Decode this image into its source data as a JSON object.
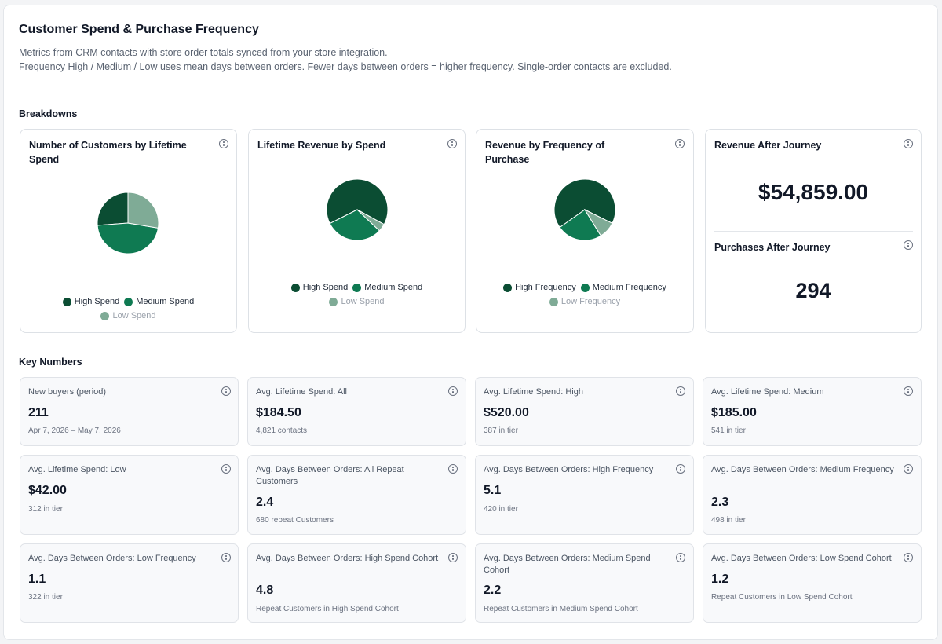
{
  "header": {
    "title": "Customer Spend & Purchase Frequency",
    "subtitle_line1": "Metrics from CRM contacts with store order totals synced from your store integration.",
    "subtitle_line2": "Frequency High / Medium / Low uses mean days between orders. Fewer days between orders = higher frequency. Single-order contacts are excluded."
  },
  "colors": {
    "high": "#0b4d33",
    "medium": "#0f7a52",
    "low": "#7fab96"
  },
  "breakdowns": {
    "label": "Breakdowns",
    "customers_by_spend": {
      "title": "Number of Customers by Lifetime Spend",
      "legend": [
        "High Spend",
        "Medium Spend",
        "Low Spend"
      ],
      "chart_data": {
        "type": "pie",
        "categories": [
          "High Spend",
          "Medium Spend",
          "Low Spend"
        ],
        "values": [
          0.262,
          0.462,
          0.276
        ]
      }
    },
    "revenue_by_spend": {
      "title": "Lifetime Revenue by Spend",
      "legend": [
        "High Spend",
        "Medium Spend",
        "Low Spend"
      ],
      "chart_data": {
        "type": "pie",
        "categories": [
          "High Spend",
          "Medium Spend",
          "Low Spend"
        ],
        "values": [
          0.654,
          0.305,
          0.041
        ]
      }
    },
    "revenue_by_frequency": {
      "title": "Revenue by Frequency of Purchase",
      "legend": [
        "High Frequency",
        "Medium Frequency",
        "Low Frequency"
      ],
      "chart_data": {
        "type": "pie",
        "categories": [
          "High Frequency",
          "Medium Frequency",
          "Low Frequency"
        ],
        "values": [
          0.671,
          0.24,
          0.089
        ]
      }
    },
    "journey": {
      "revenue_title": "Revenue After Journey",
      "revenue_value": "$54,859.00",
      "purchases_title": "Purchases After Journey",
      "purchases_value": "294"
    }
  },
  "key_numbers": {
    "label": "Key Numbers",
    "cards": [
      {
        "label": "New buyers (period)",
        "value": "211",
        "sub": "Apr 7, 2026 – May 7, 2026"
      },
      {
        "label": "Avg. Lifetime Spend: All",
        "value": "$184.50",
        "sub": "4,821 contacts"
      },
      {
        "label": "Avg. Lifetime Spend: High",
        "value": "$520.00",
        "sub": "387 in tier"
      },
      {
        "label": "Avg. Lifetime Spend: Medium",
        "value": "$185.00",
        "sub": "541 in tier"
      },
      {
        "label": "Avg. Lifetime Spend: Low",
        "value": "$42.00",
        "sub": "312 in tier"
      },
      {
        "label": "Avg. Days Between Orders: All Repeat Customers",
        "value": "2.4",
        "sub": "680 repeat Customers"
      },
      {
        "label": "Avg. Days Between Orders: High Frequency",
        "value": "5.1",
        "sub": "420 in tier"
      },
      {
        "label": "Avg. Days Between Orders: Medium Frequency",
        "value": "2.3",
        "sub": "498 in tier"
      },
      {
        "label": "Avg. Days Between Orders: Low Frequency",
        "value": "1.1",
        "sub": "322 in tier"
      },
      {
        "label": "Avg. Days Between Orders: High Spend Cohort",
        "value": "4.8",
        "sub": "Repeat Customers in High Spend Cohort"
      },
      {
        "label": "Avg. Days Between Orders: Medium Spend Cohort",
        "value": "2.2",
        "sub": "Repeat Customers in Medium Spend Cohort"
      },
      {
        "label": "Avg. Days Between Orders: Low Spend Cohort",
        "value": "1.2",
        "sub": "Repeat Customers in Low Spend Cohort"
      }
    ]
  }
}
